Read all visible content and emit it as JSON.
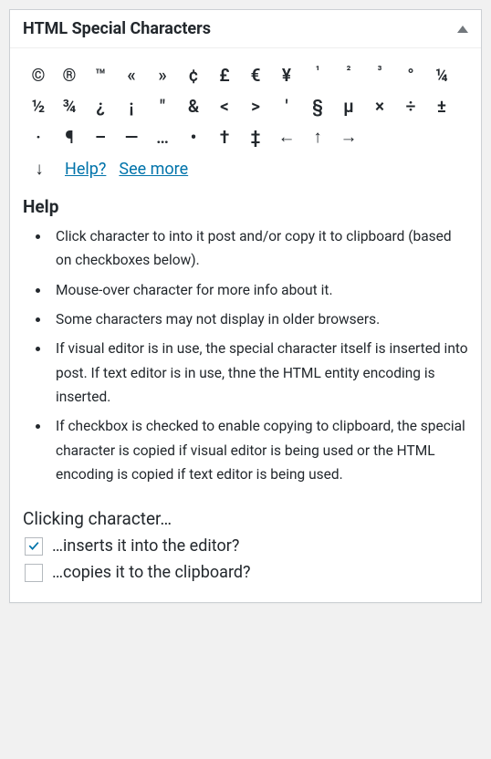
{
  "header": {
    "title": "HTML Special Characters"
  },
  "characters": {
    "row1": [
      "©",
      "®",
      "™",
      "«",
      "»",
      "¢",
      "£",
      "€",
      "¥",
      "¹",
      "²",
      "³",
      "°"
    ],
    "row2": [
      "¼",
      "½",
      "¾",
      "¿",
      "¡",
      "\"",
      "&",
      "<",
      ">",
      "'",
      "§",
      "µ",
      "×"
    ],
    "row3": [
      "÷",
      "±",
      "·",
      "¶",
      "–",
      "—",
      "…",
      "•",
      "†",
      "‡",
      "←",
      "↑",
      "→"
    ]
  },
  "links": {
    "down_arrow": "↓",
    "help": "Help?",
    "see_more": "See more"
  },
  "help": {
    "heading": "Help",
    "items": [
      "Click character to into it post and/or copy it to clipboard (based on checkboxes below).",
      "Mouse-over character for more info about it.",
      "Some characters may not display in older browsers.",
      "If visual editor is in use, the special character itself is inserted into post. If text editor is in use, thne the HTML entity encoding is inserted.",
      "If checkbox is checked to enable copying to clipboard, the special character is copied if visual editor is being used or the HTML encoding is copied if text editor is being used."
    ]
  },
  "options": {
    "heading": "Clicking character…",
    "insert": {
      "label": "…inserts it into the editor?",
      "checked": true
    },
    "copy": {
      "label": "…copies it to the clipboard?",
      "checked": false
    }
  }
}
